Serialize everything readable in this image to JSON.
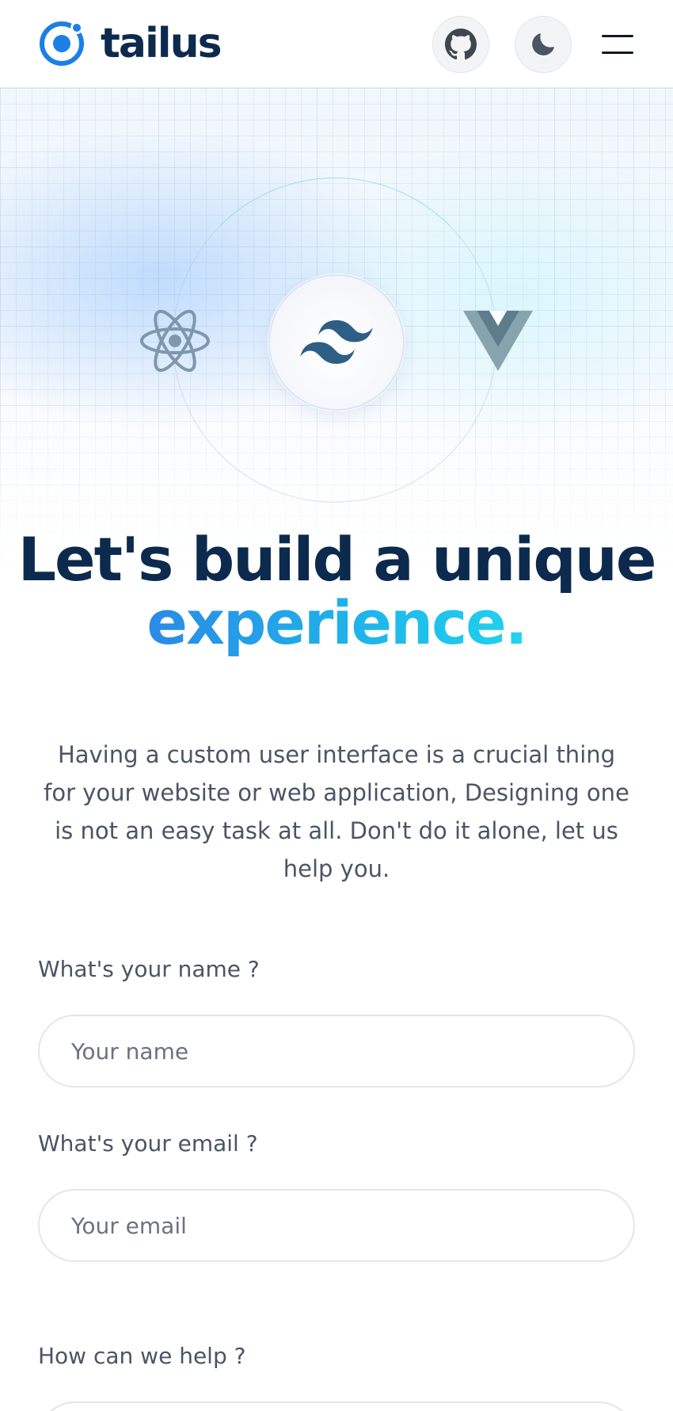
{
  "header": {
    "brand": "tailus",
    "github_icon": "github-icon",
    "theme_icon": "moon-icon",
    "menu_icon": "hamburger-menu-icon"
  },
  "hero": {
    "icons": [
      "react-icon",
      "tailwind-icon",
      "vue-icon"
    ],
    "headline": "Let's build a unique",
    "headline_accent": "experience.",
    "intro": "Having a custom user interface is a crucial thing for your website or web application, Designing one is not an easy task at all. Don't do it alone, let us help you.",
    "colors": {
      "navy": "#0c2a4d",
      "accent_start": "#2b8ae6",
      "accent_end": "#22d3ee",
      "brand_blue": "#1d7fe5"
    }
  },
  "form": {
    "name_label": "What's your name ?",
    "name_placeholder": "Your name",
    "email_label": "What's your email ?",
    "email_placeholder": "Your email",
    "help_label": "How can we help ?"
  }
}
